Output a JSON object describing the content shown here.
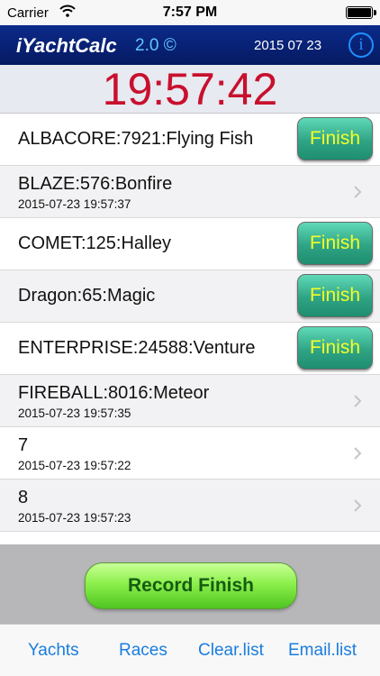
{
  "status_bar": {
    "carrier": "Carrier",
    "time": "7:57 PM"
  },
  "nav": {
    "title": "iYachtCalc",
    "version": "2.0 ©",
    "date": "2015 07 23",
    "info_icon": "info-icon"
  },
  "clock": {
    "time": "19:57:42",
    "color": "#c8102e"
  },
  "rows": [
    {
      "title": "ALBACORE:7921:Flying Fish",
      "button": "Finish"
    },
    {
      "title": "BLAZE:576:Bonfire",
      "subtitle": "2015-07-23 19:57:37"
    },
    {
      "title": "COMET:125:Halley",
      "button": "Finish"
    },
    {
      "title": "Dragon:65:Magic",
      "button": "Finish"
    },
    {
      "title": "ENTERPRISE:24588:Venture",
      "button": "Finish"
    },
    {
      "title": "FIREBALL:8016:Meteor",
      "subtitle": "2015-07-23 19:57:35"
    },
    {
      "title": "7",
      "subtitle": "2015-07-23 19:57:22"
    },
    {
      "title": "8",
      "subtitle": "2015-07-23 19:57:23"
    }
  ],
  "record_button": "Record Finish",
  "tabs": [
    "Yachts",
    "Races",
    "Clear.list",
    "Email.list"
  ],
  "colors": {
    "nav_background": "#0b2a8a",
    "finish_text": "#f4ff28",
    "tab_text": "#1a7de0",
    "record_text": "#165c12"
  }
}
